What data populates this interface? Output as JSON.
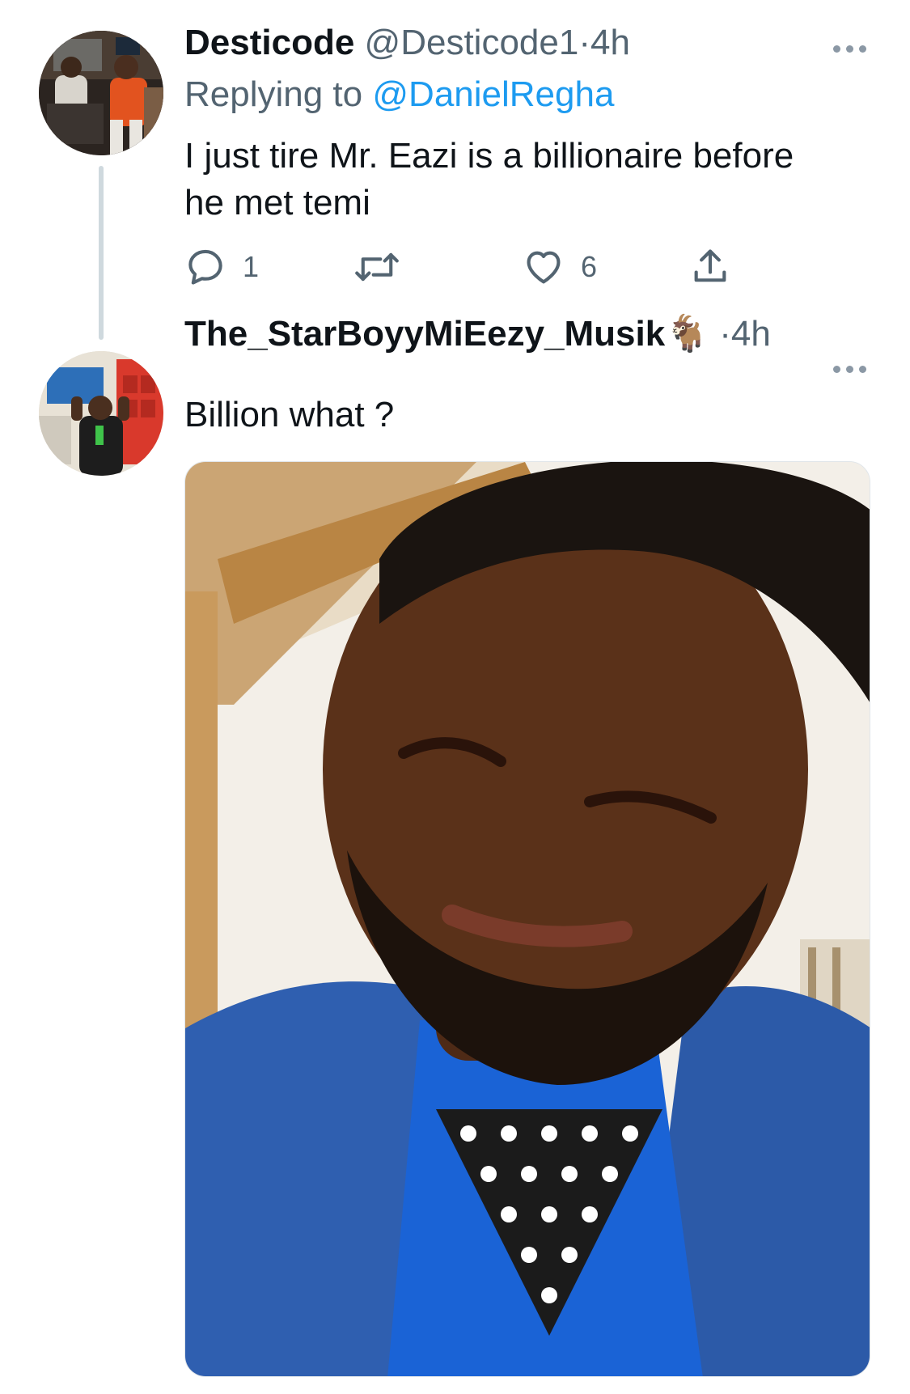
{
  "tweets": [
    {
      "name": "Desticode",
      "handle": "@Desticode1",
      "separator": "·",
      "time": "4h",
      "replying_prefix": "Replying to",
      "replying_to": "@DanielRegha",
      "text_line1": "I just tire Mr. Eazi is a billionaire before",
      "text_line2": "he met temi",
      "reply_count": "1",
      "retweet_count": "",
      "like_count": "6"
    },
    {
      "name": "The_StarBoyyMiEezy_Musik",
      "emoji": "🐐",
      "separator": "·",
      "time": "4h",
      "text": "Billion what ?"
    }
  ],
  "icons": {
    "reply": "speech-bubble-icon",
    "retweet": "retweet-icon",
    "like": "heart-icon",
    "share": "share-upload-icon",
    "more": "more-horizontal-icon"
  },
  "colors": {
    "link": "#1d9bf0",
    "muted": "#536471",
    "text": "#0f1419",
    "thread_line": "#cfd9de"
  }
}
